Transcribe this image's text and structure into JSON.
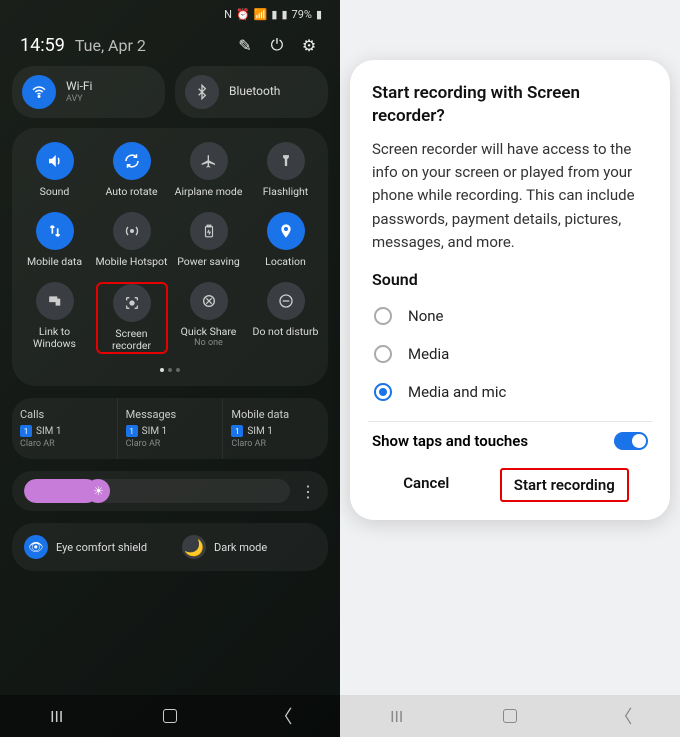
{
  "left": {
    "status": {
      "battery": "79%"
    },
    "time": "14:59",
    "date": "Tue, Apr 2",
    "pills": {
      "wifi": {
        "label": "Wi-Fi",
        "sub": "AVY"
      },
      "bluetooth": {
        "label": "Bluetooth"
      }
    },
    "tiles": [
      [
        {
          "label": "Sound",
          "active": true
        },
        {
          "label": "Auto rotate",
          "active": true
        },
        {
          "label": "Airplane mode",
          "active": false
        },
        {
          "label": "Flashlight",
          "active": false
        }
      ],
      [
        {
          "label": "Mobile data",
          "active": true
        },
        {
          "label": "Mobile Hotspot",
          "active": false
        },
        {
          "label": "Power saving",
          "active": false
        },
        {
          "label": "Location",
          "active": true
        }
      ],
      [
        {
          "label": "Link to Windows",
          "active": false
        },
        {
          "label": "Screen recorder",
          "active": false,
          "highlight": true
        },
        {
          "label": "Quick Share",
          "sub": "No one",
          "active": false
        },
        {
          "label": "Do not disturb",
          "active": false
        }
      ]
    ],
    "sims": {
      "cols": [
        {
          "h": "Calls",
          "num": "1",
          "sim": "SIM 1",
          "carrier": "Claro AR"
        },
        {
          "h": "Messages",
          "num": "1",
          "sim": "SIM 1",
          "carrier": "Claro AR"
        },
        {
          "h": "Mobile data",
          "num": "1",
          "sim": "SIM 1",
          "carrier": "Claro AR"
        }
      ]
    },
    "modes": {
      "eye": "Eye comfort shield",
      "dark": "Dark mode"
    }
  },
  "right": {
    "title": "Start recording with Screen recorder?",
    "body": "Screen recorder will have access to the info on your screen or played from your phone while recording. This can include passwords, payment details, pictures, messages, and more.",
    "sound_header": "Sound",
    "options": [
      "None",
      "Media",
      "Media and mic"
    ],
    "selected": 2,
    "show_taps": "Show taps and touches",
    "cancel": "Cancel",
    "start": "Start recording"
  }
}
